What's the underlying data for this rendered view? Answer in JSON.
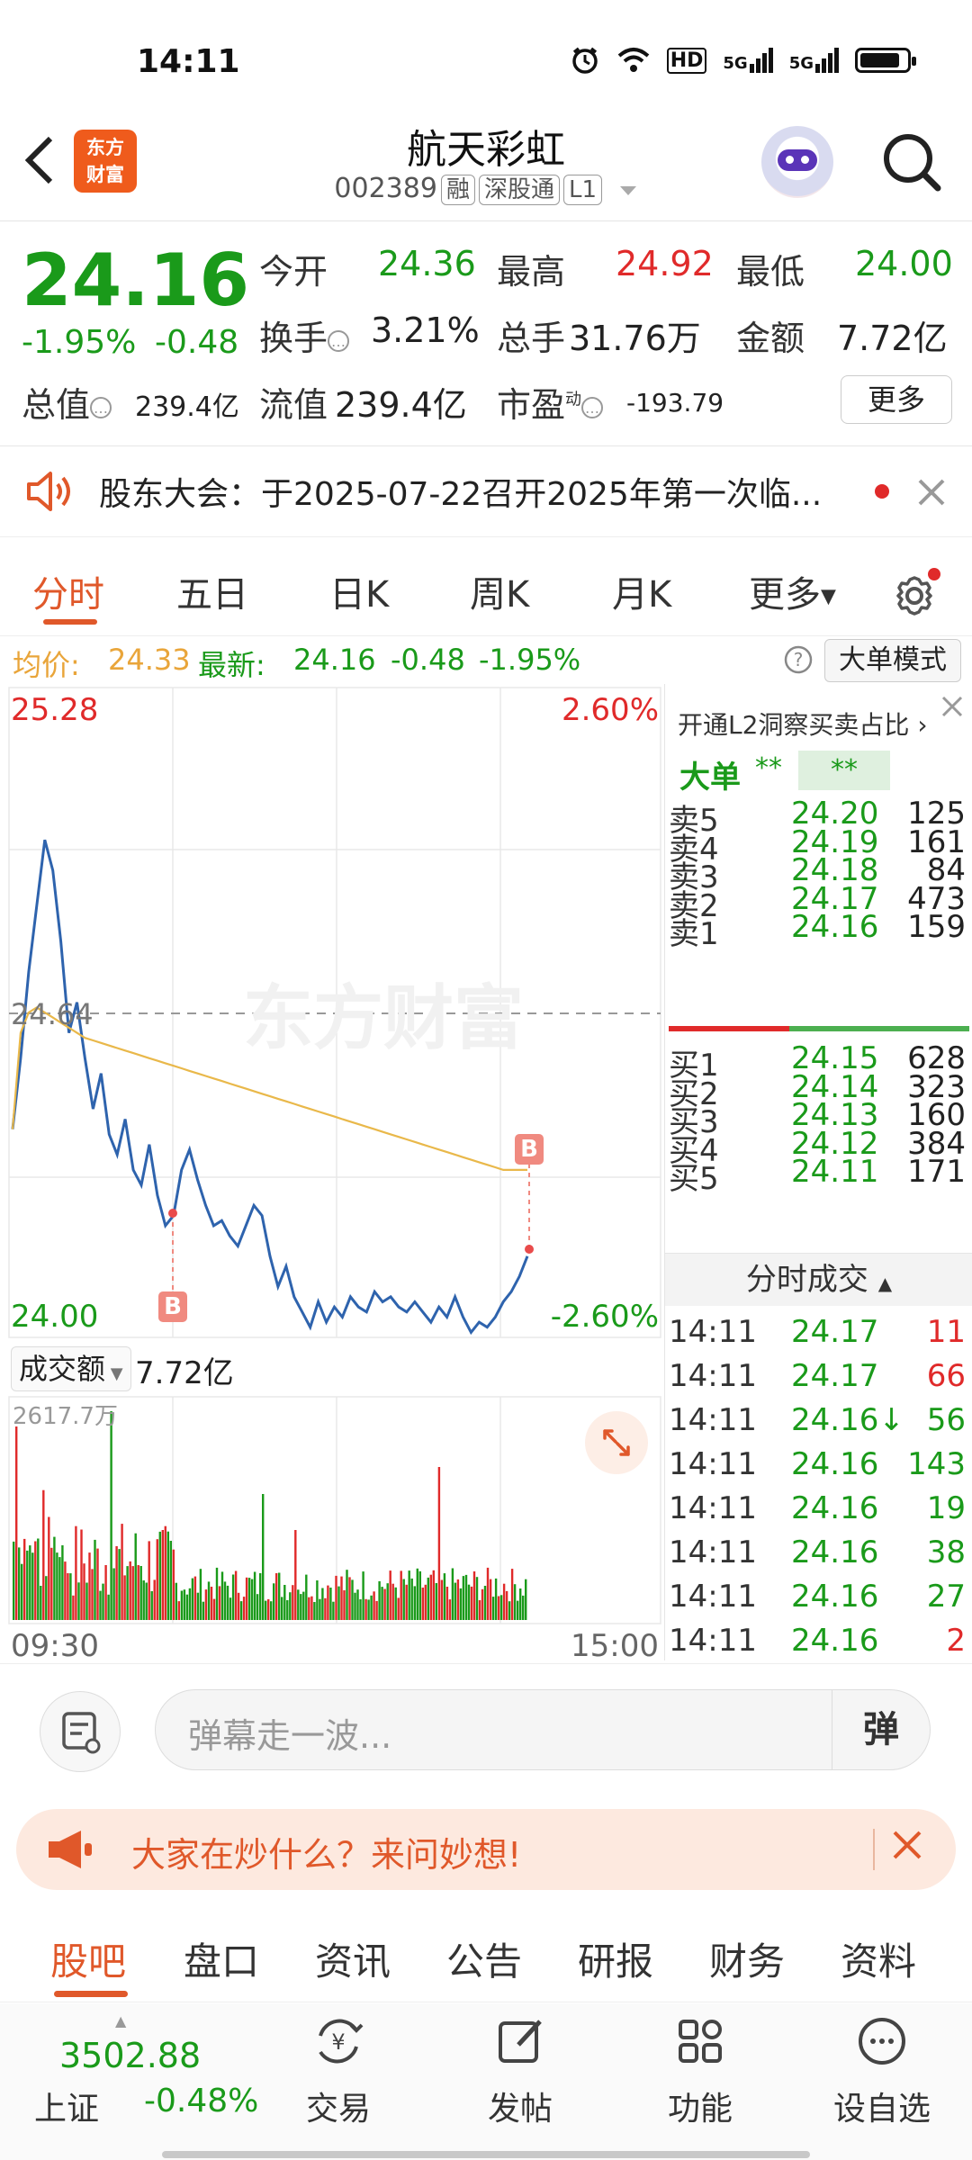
{
  "status_bar": {
    "time": "14:11",
    "network_hd": "HD",
    "signal_1": "5G",
    "signal_2": "5G",
    "battery_level": 0.85
  },
  "header": {
    "back_icon": "chevron-left-icon",
    "brand_logo": "东方\n财富",
    "stock_name": "航天彩虹",
    "stock_code": "002389",
    "tags": [
      "融",
      "深股通",
      "L1"
    ],
    "avatar_icon": "robot-avatar",
    "search_icon": "search-icon"
  },
  "quote": {
    "price": "24.16",
    "change_pct": "-1.95%",
    "change_abs": "-0.48",
    "open_label": "今开",
    "open": "24.36",
    "high_label": "最高",
    "high": "24.92",
    "low_label": "最低",
    "low": "24.00",
    "turnover_label": "换手",
    "turnover": "3.21%",
    "volume_label": "总手",
    "volume": "31.76万",
    "amount_label": "金额",
    "amount": "7.72亿",
    "mktcap_label": "总值",
    "mktcap": "239.4亿",
    "float_label": "流值",
    "float": "239.4亿",
    "pe_label": "市盈",
    "pe_sup": "动",
    "pe": "-193.79",
    "more": "更多"
  },
  "notice": {
    "text": "股东大会：于2025-07-22召开2025年第一次临...",
    "icon": "speaker-icon"
  },
  "chart_tabs": {
    "tabs": [
      "分时",
      "五日",
      "日K",
      "周K",
      "月K",
      "更多"
    ],
    "active": 0
  },
  "avg_bar": {
    "avg_label": "均价:",
    "avg": "24.33",
    "latest_label": "最新:",
    "latest": "24.16",
    "chg": "-0.48",
    "pct": "-1.95%",
    "mode_button": "大单模式"
  },
  "chart": {
    "ymax": "25.28",
    "ymin": "24.00",
    "pct_max": "2.60%",
    "pct_min": "-2.60%",
    "ref": "24.64",
    "watermark": "东方财富",
    "volume_label": "成交额",
    "volume_total": "7.72亿",
    "volume_max": "2617.7万",
    "time_start": "09:30",
    "time_end": "15:00",
    "marker": "B"
  },
  "chart_data": {
    "type": "line",
    "ylim": [
      24.0,
      25.28
    ],
    "ref_price": 24.64,
    "series": [
      {
        "name": "价格",
        "values": [
          24.41,
          24.55,
          24.72,
          24.85,
          24.98,
          24.92,
          24.78,
          24.6,
          24.66,
          24.55,
          24.45,
          24.52,
          24.4,
          24.36,
          24.43,
          24.33,
          24.3,
          24.38,
          24.28,
          24.22,
          24.24,
          24.33,
          24.37,
          24.31,
          24.26,
          24.22,
          24.23,
          24.2,
          24.18,
          24.22,
          24.26,
          24.24,
          24.16,
          24.1,
          24.14,
          24.08,
          24.05,
          24.02,
          24.07,
          24.03,
          24.06,
          24.04,
          24.08,
          24.06,
          24.05,
          24.09,
          24.07,
          24.08,
          24.06,
          24.05,
          24.07,
          24.05,
          24.03,
          24.06,
          24.04,
          24.08,
          24.04,
          24.01,
          24.03,
          24.02,
          24.04,
          24.07,
          24.09,
          24.12,
          24.16
        ]
      },
      {
        "name": "均价",
        "values": [
          24.41,
          24.6,
          24.64,
          24.65,
          24.64,
          24.63,
          24.62,
          24.61,
          24.6,
          24.59,
          24.585,
          24.58,
          24.575,
          24.57,
          24.565,
          24.56,
          24.555,
          24.55,
          24.545,
          24.54,
          24.535,
          24.53,
          24.525,
          24.52,
          24.515,
          24.51,
          24.505,
          24.5,
          24.495,
          24.49,
          24.485,
          24.48,
          24.475,
          24.47,
          24.465,
          24.46,
          24.455,
          24.45,
          24.445,
          24.44,
          24.435,
          24.43,
          24.425,
          24.42,
          24.415,
          24.41,
          24.405,
          24.4,
          24.395,
          24.39,
          24.385,
          24.38,
          24.375,
          24.37,
          24.365,
          24.36,
          24.355,
          24.35,
          24.345,
          24.34,
          24.335,
          24.33,
          24.33,
          24.33,
          24.33
        ]
      }
    ]
  },
  "orderbook": {
    "header": "开通L2洞察买卖占比",
    "big_label": "大单",
    "big_val1": "**",
    "big_val2": "**",
    "asks": [
      {
        "label": "卖5",
        "price": "24.20",
        "vol": "125"
      },
      {
        "label": "卖4",
        "price": "24.19",
        "vol": "161"
      },
      {
        "label": "卖3",
        "price": "24.18",
        "vol": "84"
      },
      {
        "label": "卖2",
        "price": "24.17",
        "vol": "473"
      },
      {
        "label": "卖1",
        "price": "24.16",
        "vol": "159"
      }
    ],
    "bids": [
      {
        "label": "买1",
        "price": "24.15",
        "vol": "628"
      },
      {
        "label": "买2",
        "price": "24.14",
        "vol": "323"
      },
      {
        "label": "买3",
        "price": "24.13",
        "vol": "160"
      },
      {
        "label": "买4",
        "price": "24.12",
        "vol": "384"
      },
      {
        "label": "买5",
        "price": "24.11",
        "vol": "171"
      }
    ],
    "ticks_title": "分时成交",
    "ticks": [
      {
        "t": "14:11",
        "p": "24.17",
        "v": "11",
        "c": "red"
      },
      {
        "t": "14:11",
        "p": "24.17",
        "v": "66",
        "c": "red"
      },
      {
        "t": "14:11",
        "p": "24.16↓",
        "v": "56",
        "c": "green"
      },
      {
        "t": "14:11",
        "p": "24.16",
        "v": "143",
        "c": "green"
      },
      {
        "t": "14:11",
        "p": "24.16",
        "v": "19",
        "c": "green"
      },
      {
        "t": "14:11",
        "p": "24.16",
        "v": "38",
        "c": "green"
      },
      {
        "t": "14:11",
        "p": "24.16",
        "v": "27",
        "c": "green"
      },
      {
        "t": "14:11",
        "p": "24.16",
        "v": "2",
        "c": "red"
      }
    ]
  },
  "danmu": {
    "placeholder": "弹幕走一波...",
    "send": "弹"
  },
  "ask_banner": {
    "text": "大家在炒什么？来问妙想!"
  },
  "bottom_tabs": {
    "tabs": [
      "股吧",
      "盘口",
      "资讯",
      "公告",
      "研报",
      "财务",
      "资料"
    ],
    "active": 0
  },
  "navbar": {
    "index_value": "3502.88",
    "index_name": "上证",
    "index_chg": "-0.48%",
    "items": [
      {
        "label": "交易",
        "icon": "trade-icon"
      },
      {
        "label": "发帖",
        "icon": "post-icon"
      },
      {
        "label": "功能",
        "icon": "grid-icon"
      },
      {
        "label": "设自选",
        "icon": "more-circle-icon"
      }
    ]
  },
  "colors": {
    "up": "#e02a2a",
    "down": "#1a9a1a",
    "accent": "#e0582a",
    "price_line": "#2e63ad",
    "avg_line": "#e9b84a"
  }
}
